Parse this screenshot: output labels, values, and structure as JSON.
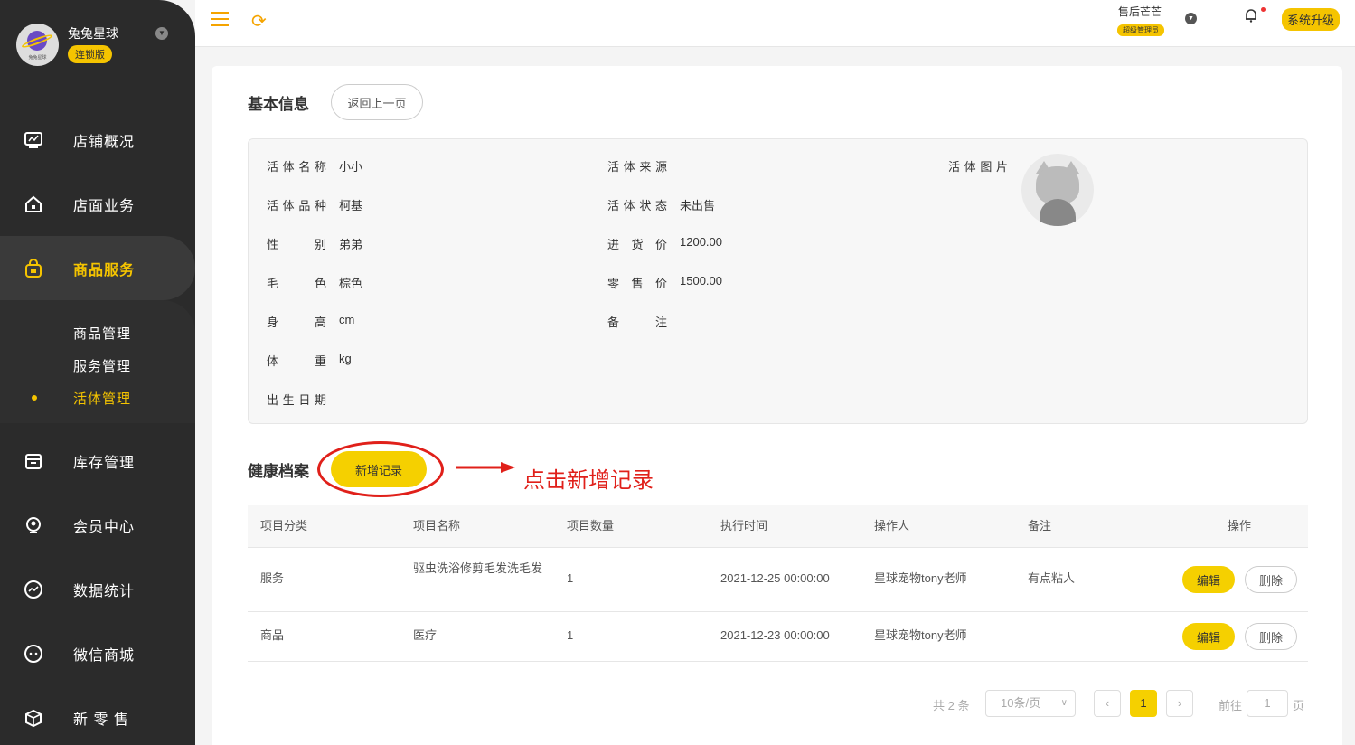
{
  "brand": {
    "name": "兔兔星球",
    "badge": "连锁版",
    "logo_caption": "兔兔星球"
  },
  "topbar": {
    "user_name": "售后芒芒",
    "user_role": "超级管理员",
    "upgrade": "系统升级"
  },
  "sidebar": {
    "items": [
      {
        "label": "店铺概况",
        "icon": "monitor-icon"
      },
      {
        "label": "店面业务",
        "icon": "home-icon"
      },
      {
        "label": "商品服务",
        "icon": "bag-icon",
        "active": true
      },
      {
        "label": "库存管理",
        "icon": "archive-icon"
      },
      {
        "label": "会员中心",
        "icon": "member-icon"
      },
      {
        "label": "数据统计",
        "icon": "chart-icon"
      },
      {
        "label": "微信商城",
        "icon": "chat-icon"
      },
      {
        "label": "新 零 售",
        "icon": "box-icon"
      }
    ],
    "sub_items": [
      {
        "label": "商品管理"
      },
      {
        "label": "服务管理"
      },
      {
        "label": "活体管理",
        "active": true
      }
    ]
  },
  "basic": {
    "title": "基本信息",
    "back": "返回上一页",
    "fields_left": [
      {
        "key": "活体名称",
        "value": "小小"
      },
      {
        "key": "活体品种",
        "value": "柯基"
      },
      {
        "key": "性别",
        "value": "弟弟"
      },
      {
        "key": "毛色",
        "value": "棕色"
      },
      {
        "key": "身高",
        "value": "cm"
      },
      {
        "key": "体重",
        "value": "kg"
      },
      {
        "key": "出生日期",
        "value": ""
      }
    ],
    "fields_mid": [
      {
        "key": "活体来源",
        "value": ""
      },
      {
        "key": "活体状态",
        "value": "未出售"
      },
      {
        "key": "进货价",
        "value": "1200.00"
      },
      {
        "key": "零售价",
        "value": "1500.00"
      },
      {
        "key": "备注",
        "value": ""
      }
    ],
    "photo_key": "活体图片"
  },
  "health": {
    "title": "健康档案",
    "add_button": "新增记录",
    "annotation": "点击新增记录",
    "columns": [
      "项目分类",
      "项目名称",
      "项目数量",
      "执行时间",
      "操作人",
      "备注",
      "操作"
    ],
    "rows": [
      {
        "category": "服务",
        "name": "驱虫洗浴修剪毛发洗毛发",
        "qty": "1",
        "time": "2021-12-25 00:00:00",
        "operator": "星球宠物tony老师",
        "note": "有点粘人",
        "edit": "编辑",
        "delete": "删除"
      },
      {
        "category": "商品",
        "name": "医疗",
        "qty": "1",
        "time": "2021-12-23 00:00:00",
        "operator": "星球宠物tony老师",
        "note": "",
        "edit": "编辑",
        "delete": "删除"
      }
    ]
  },
  "pager": {
    "total": "共 2 条",
    "page_size": "10条/页",
    "current": "1",
    "goto_prefix": "前往",
    "goto_value": "1",
    "goto_suffix": "页"
  },
  "colors": {
    "accent": "#f5d000",
    "sidebar": "#2b2b2b",
    "annotation": "#e0201a"
  }
}
